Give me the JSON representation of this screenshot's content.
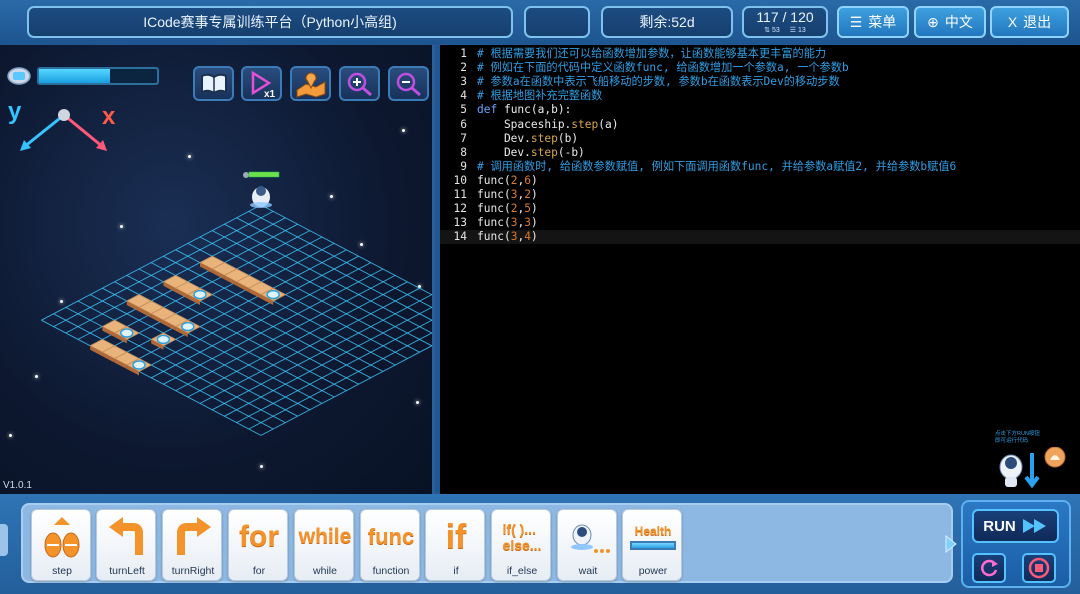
{
  "header": {
    "title": "ICode赛事专属训练平台（Python小高组)",
    "empty_box": "",
    "remaining": "剩余:52d",
    "progress_main": "117 / 120",
    "progress_sub_a": "53",
    "progress_sub_b": "13",
    "menu_label": "菜单",
    "lang_label": "中文",
    "exit_label": "退出"
  },
  "game": {
    "energy_level_percent": 60,
    "axis_y": "y",
    "axis_x": "x",
    "version": "V1.0.1",
    "tools": [
      "book-icon",
      "speed-x1-icon",
      "map-icon",
      "zoom-in-icon",
      "zoom-out-icon"
    ]
  },
  "code": {
    "lines": [
      {
        "n": "1",
        "t": "# 根据需要我们还可以给函数增加参数，让函数能够基本更丰富的能力"
      },
      {
        "n": "2",
        "t": "# 例如在下面的代码中定义函数func, 给函数增加一个参数a, 一个参数b"
      },
      {
        "n": "3",
        "t": "# 参数a在函数中表示飞船移动的步数, 参数b在函数表示Dev的移动步数"
      },
      {
        "n": "4",
        "t": "# 根据地图补充完整函数"
      },
      {
        "n": "5",
        "t": "def func(a,b):"
      },
      {
        "n": "6",
        "t": "    Spaceship.step(a)"
      },
      {
        "n": "7",
        "t": "    Dev.step(b)"
      },
      {
        "n": "8",
        "t": "    Dev.step(-b)"
      },
      {
        "n": "9",
        "t": "# 调用函数时, 给函数参数赋值, 例如下面调用函数func, 并给参数a赋值2, 并给参数b赋值6"
      },
      {
        "n": "10",
        "t": "func(2,6)"
      },
      {
        "n": "11",
        "t": "func(3,2)"
      },
      {
        "n": "12",
        "t": "func(2,5)"
      },
      {
        "n": "13",
        "t": "func(3,3)"
      },
      {
        "n": "14",
        "t": "func(3,4)"
      }
    ],
    "helper_line1": "点击下方RUN按钮",
    "helper_line2": "即可运行代码"
  },
  "palette": {
    "blocks": [
      {
        "label": "step",
        "word": ""
      },
      {
        "label": "turnLeft",
        "word": ""
      },
      {
        "label": "turnRight",
        "word": ""
      },
      {
        "label": "for",
        "word": "for"
      },
      {
        "label": "while",
        "word": "while"
      },
      {
        "label": "function",
        "word": "func"
      },
      {
        "label": "if",
        "word": "if"
      },
      {
        "label": "if_else",
        "word": "if( )...\nelse..."
      },
      {
        "label": "wait",
        "word": ""
      },
      {
        "label": "power",
        "word": "Health"
      }
    ],
    "run_label": "RUN"
  },
  "colors": {
    "accent": "#2f9fe6",
    "orange": "#f4932a"
  }
}
